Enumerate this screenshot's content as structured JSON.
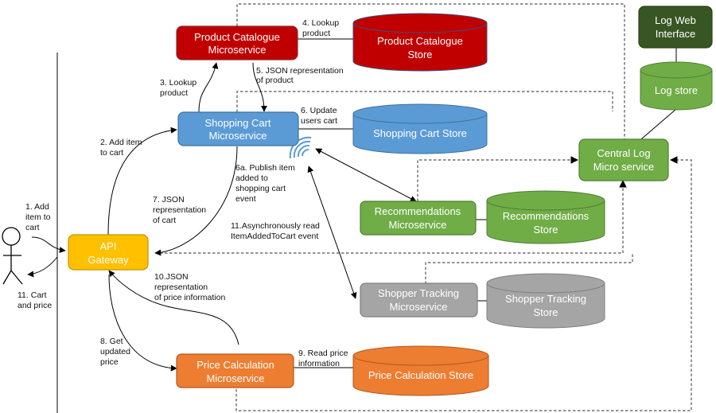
{
  "colors": {
    "red": "#C00000",
    "blue": "#5B9BD5",
    "green": "#70AD47",
    "dark_green": "#375623",
    "gray": "#A5A5A5",
    "orange": "#ED7D31",
    "yellow": "#FFC000"
  },
  "nodes": {
    "product_catalogue_ms": {
      "line1": "Product Catalogue",
      "line2": "Microservice"
    },
    "product_catalogue_store": {
      "line1": "Product Catalogue",
      "line2": "Store"
    },
    "shopping_cart_ms": {
      "line1": "Shopping Cart",
      "line2": "Microservice"
    },
    "shopping_cart_store": {
      "line1": "Shopping Cart Store"
    },
    "api_gateway": {
      "line1": "API",
      "line2": "Gateway"
    },
    "recommendations_ms": {
      "line1": "Recommendations",
      "line2": "Microservice"
    },
    "recommendations_store": {
      "line1": "Recommendations",
      "line2": "Store"
    },
    "shopper_tracking_ms": {
      "line1": "Shopper Tracking",
      "line2": "Microservice"
    },
    "shopper_tracking_store": {
      "line1": "Shopper Tracking",
      "line2": "Store"
    },
    "price_calculation_ms": {
      "line1": "Price Calculation",
      "line2": "Microservice"
    },
    "price_calculation_store": {
      "line1": "Price Calculation Store"
    },
    "central_log_ms": {
      "line1": "Central Log",
      "line2": "Micro service"
    },
    "log_store": {
      "line1": "Log store"
    },
    "log_web_interface": {
      "line1": "Log Web",
      "line2": "Interface"
    }
  },
  "labels": {
    "step1": [
      "1. Add",
      "item to",
      "cart"
    ],
    "step11_user": [
      "11. Cart",
      "and price"
    ],
    "step2": [
      "2. Add item",
      "to cart"
    ],
    "step3": [
      "3. Lookup",
      "product"
    ],
    "step4": [
      "4. Lookup",
      "product"
    ],
    "step5": [
      "5. JSON representation",
      "of product"
    ],
    "step6": [
      "6. Update",
      "users cart"
    ],
    "step6a": [
      "6a. Publish item",
      "added to",
      "shopping cart",
      "event"
    ],
    "step7": [
      "7. JSON",
      "representation",
      "of cart"
    ],
    "step11_async": [
      "11.Asynchronously read",
      "ItemAddedToCart event"
    ],
    "step10": [
      "10.JSON",
      "representation",
      "of price information"
    ],
    "step8": [
      "8. Get",
      "updated",
      "price"
    ],
    "step9": [
      "9. Read price",
      "information"
    ]
  }
}
